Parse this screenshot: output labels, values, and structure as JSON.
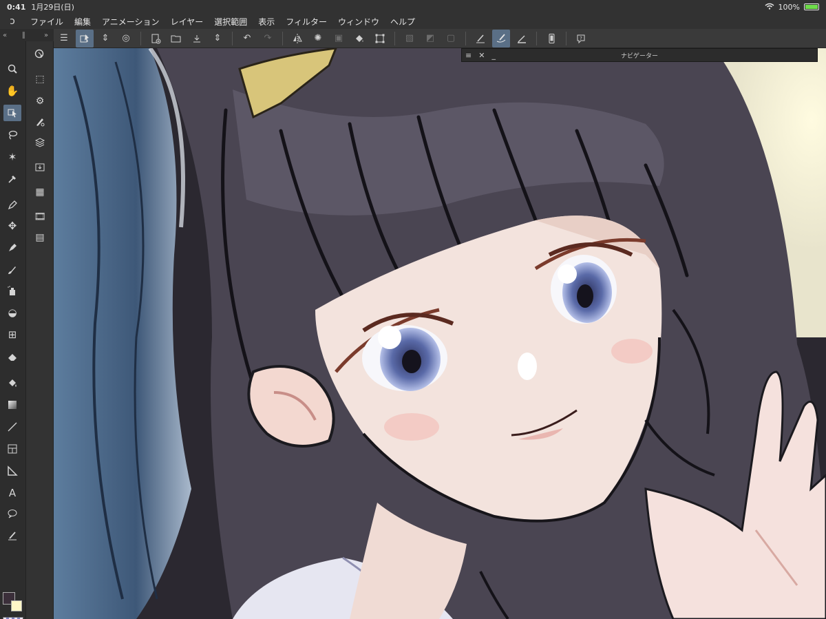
{
  "status_bar": {
    "time": "0:41",
    "date": "1月29日(日)",
    "battery": "100%"
  },
  "menubar": {
    "logo_icon": "clip-studio-logo-icon",
    "items": [
      "ファイル",
      "編集",
      "アニメーション",
      "レイヤー",
      "選択範囲",
      "表示",
      "フィルター",
      "ウィンドウ",
      "ヘルプ"
    ]
  },
  "left_strip": {
    "collapse_left": "«",
    "handle": "∥",
    "collapse_right": "»"
  },
  "navigator": {
    "title": "ナビゲーター",
    "menu_icon": "≡",
    "close_icon": "✕",
    "minimize_icon": "_"
  },
  "colors": {
    "main_color": "#3b2f3a",
    "sub_color": "#fff7c8",
    "accent": "#5a6f86"
  },
  "toolbar_icons": [
    "menu-icon",
    "select-layer-icon",
    "stepper-icon",
    "spiral-icon",
    "new-canvas-icon",
    "open-folder-icon",
    "save-icon",
    "stepper-icon",
    "undo-icon",
    "redo-icon",
    "flip-horizontal-icon",
    "loading-icon",
    "layer-property-icon",
    "fill-icon",
    "transform-icon",
    "clear-selection-icon",
    "invert-selection-icon",
    "convert-selection-icon",
    "pen-correction-icon",
    "smoothing-brush-icon",
    "ruler-icon",
    "smartphone-icon",
    "help-icon"
  ]
}
